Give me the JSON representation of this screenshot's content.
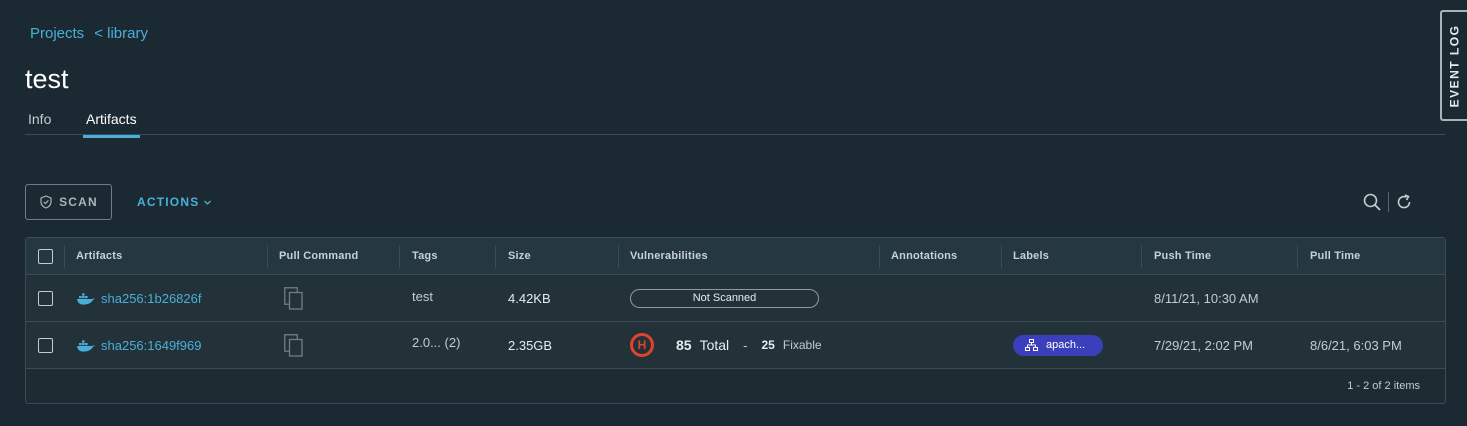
{
  "breadcrumb": {
    "projects": "Projects",
    "library": "< library"
  },
  "page_title": "test",
  "tabs": [
    {
      "label": "Info"
    },
    {
      "label": "Artifacts"
    }
  ],
  "event_log": "EVENT LOG",
  "toolbar": {
    "scan_label": "SCAN",
    "actions_label": "ACTIONS"
  },
  "grid": {
    "headers": [
      "Artifacts",
      "Pull Command",
      "Tags",
      "Size",
      "Vulnerabilities",
      "Annotations",
      "Labels",
      "Push Time",
      "Pull Time"
    ],
    "rows": [
      {
        "artifact": "sha256:1b26826f",
        "tags": "test",
        "size": "4.42KB",
        "vulnerabilities": "Not Scanned",
        "labels": "",
        "push_time": "8/11/21, 10:30 AM",
        "pull_time": ""
      },
      {
        "artifact": "sha256:1649f969",
        "tags": "2.0... (2)",
        "size": "2.35GB",
        "severity": "H",
        "total_count": "85",
        "total_word": "Total",
        "dash": "-",
        "fixable_count": "25",
        "fixable_word": "Fixable",
        "labels": "apach...",
        "push_time": "7/29/21, 2:02 PM",
        "pull_time": "8/6/21, 6:03 PM"
      }
    ],
    "footer": "1 - 2 of 2 items"
  },
  "colors": {
    "accent": "#49afd9",
    "severity_high": "#e0422c",
    "label_bg": "#3b3fbb",
    "background": "#1b2a32"
  }
}
